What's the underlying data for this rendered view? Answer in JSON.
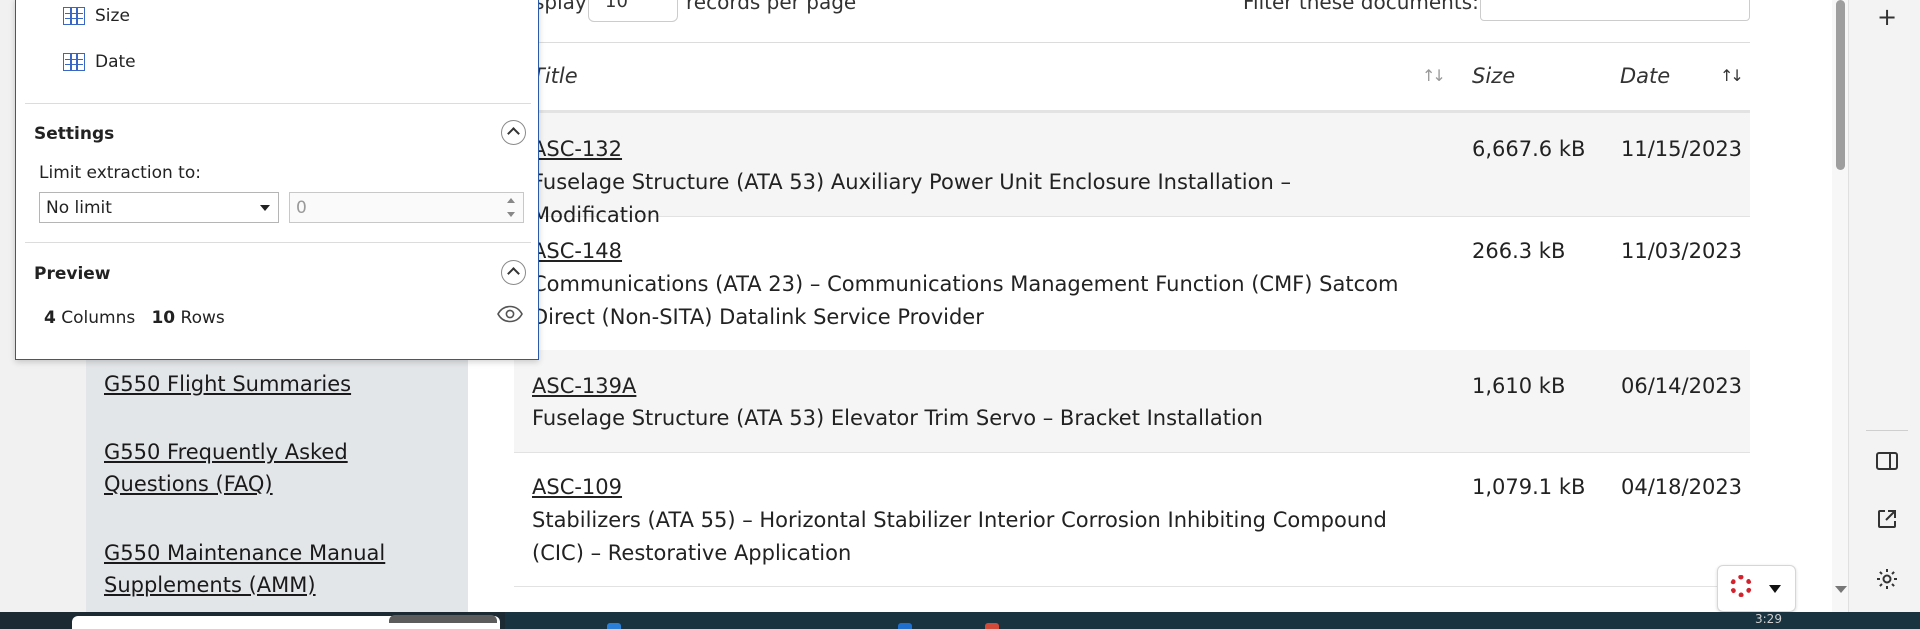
{
  "toolbar": {
    "display_prefix": "splay",
    "per_page_value": "10",
    "per_page_suffix": "records per page",
    "filter_label": "Filter these documents:"
  },
  "table": {
    "headers": {
      "title": "Title",
      "size": "Size",
      "date": "Date"
    },
    "rows": [
      {
        "id": "ASC-132",
        "title": "Fuselage Structure (ATA 53) Auxiliary Power Unit Enclosure Installation – Modification",
        "size": "6,667.6 kB",
        "date": "11/15/2023"
      },
      {
        "id": "ASC-148",
        "title": "Communications (ATA 23) – Communications Management Function (CMF) Satcom Direct (Non-SITA) Datalink Service Provider",
        "size": "266.3 kB",
        "date": "11/03/2023"
      },
      {
        "id": "ASC-139A",
        "title": "Fuselage Structure (ATA 53) Elevator Trim Servo – Bracket Installation",
        "size": "1,610 kB",
        "date": "06/14/2023"
      },
      {
        "id": "ASC-109",
        "title": "Stabilizers (ATA 55) – Horizontal Stabilizer Interior Corrosion Inhibiting Compound (CIC) – Restorative Application",
        "size": "1,079.1 kB",
        "date": "04/18/2023"
      }
    ]
  },
  "sidebar": {
    "links": [
      "G550 Flight Summaries",
      "G550 Frequently Asked Questions (FAQ)",
      "G550 Maintenance Manual Supplements (AMM)"
    ]
  },
  "panel": {
    "columns": [
      "Size",
      "Date"
    ],
    "settings": {
      "heading": "Settings",
      "limit_label": "Limit extraction to:",
      "limit_value": "No limit",
      "limit_number": "0"
    },
    "preview": {
      "heading": "Preview",
      "columns_count": "4",
      "columns_word": "Columns",
      "rows_count": "10",
      "rows_word": "Rows"
    }
  },
  "taskbar": {
    "clock": "3:29"
  },
  "colors": {
    "accent": "#2d5aa8",
    "sidebar_bg": "#e3e6e9",
    "help_spinner": "#d2222d"
  }
}
